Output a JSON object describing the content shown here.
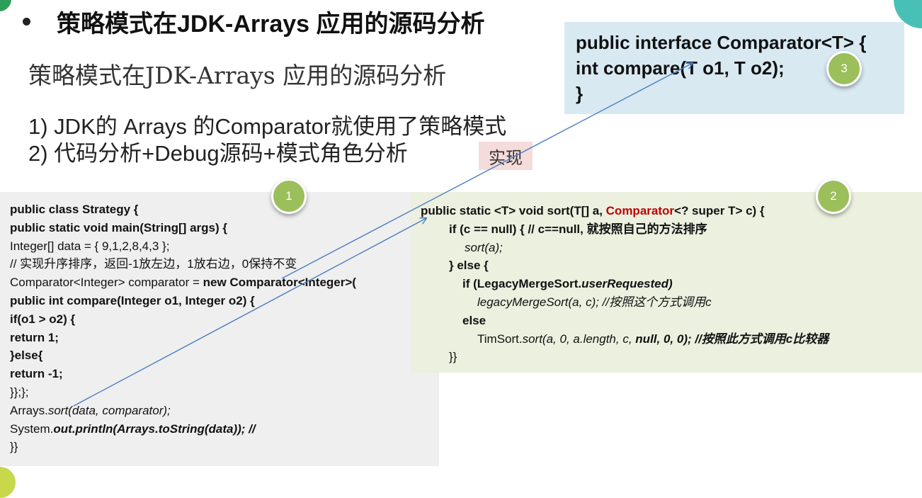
{
  "title": "策略模式在JDK-Arrays 应用的源码分析",
  "subtitle": "策略模式在JDK-Arrays 应用的源码分析",
  "list": [
    "1)  JDK的 Arrays 的Comparator就使用了策略模式",
    "2)  代码分析+Debug源码+模式角色分析"
  ],
  "impl_tag": "实现",
  "badges": [
    "1",
    "2",
    "3"
  ],
  "interface_code": [
    "public interface Comparator<T> {",
    "int compare(T o1, T o2);",
    "}"
  ],
  "left_code": {
    "l1": "public class Strategy {",
    "l2": "public static void main(String[] args) {",
    "l3": "Integer[] data = { 9,1,2,8,4,3 };",
    "l4": "// 实现升序排序，返回-1放左边，1放右边，0保持不变",
    "l5a": "Comparator<Integer> comparator = ",
    "l5b": "new Comparator<Integer>(",
    "l6": "public int compare(Integer o1, Integer o2) {",
    "l7": "if(o1 > o2) {",
    "l8": "return 1;",
    "l9": "}else{",
    "l10": "return -1;",
    "l11": "}};};",
    "l12a": "Arrays.",
    "l12b": "sort(data, comparator);",
    "l13a": "System.",
    "l13b": "out.println(Arrays.toString(data)); //",
    "l14": "}}"
  },
  "right_code": {
    "r1a": "public static <T> void sort(T[] a, ",
    "r1b": "Comparator",
    "r1c": "<? super T> c) {",
    "r2": "if (c == null) { // c==null, 就按照自己的方法排序",
    "r3": "sort(a);",
    "r4": "} else {",
    "r5a": "if (LegacyMergeSort.",
    "r5b": "userRequested)",
    "r6": "legacyMergeSort(a, c); //按照这个方式调用c",
    "r7": "else",
    "r8a": "TimSort.",
    "r8b": "sort(a, 0, a.length, c, ",
    "r8c": "null, 0, 0); //按照此方式调用c比较器",
    "r9": "}}"
  },
  "colors": {
    "interface_bg": "#d8e9f2",
    "left_code_bg": "#efefef",
    "right_code_bg": "#ebf0df",
    "impl_tag_bg": "#f6dbdb",
    "badge": "#9bbf5a",
    "arrow": "#4a7ec0",
    "highlight": "#c00000"
  }
}
